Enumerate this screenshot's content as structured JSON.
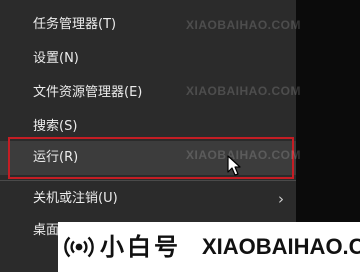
{
  "menu": {
    "items": [
      {
        "label": "任务管理器(T)"
      },
      {
        "label": "设置(N)"
      },
      {
        "label": "文件资源管理器(E)"
      },
      {
        "label": "搜索(S)"
      },
      {
        "label": "运行(R)"
      },
      {
        "label": "关机或注销(U)"
      },
      {
        "label": "桌面"
      }
    ],
    "submenu_arrow": "›"
  },
  "watermark": {
    "text": "XIAOBAIHAO.COM"
  },
  "brand": {
    "cn_text": "小白号",
    "en_text": "XIAOBAIHAO.COM"
  }
}
